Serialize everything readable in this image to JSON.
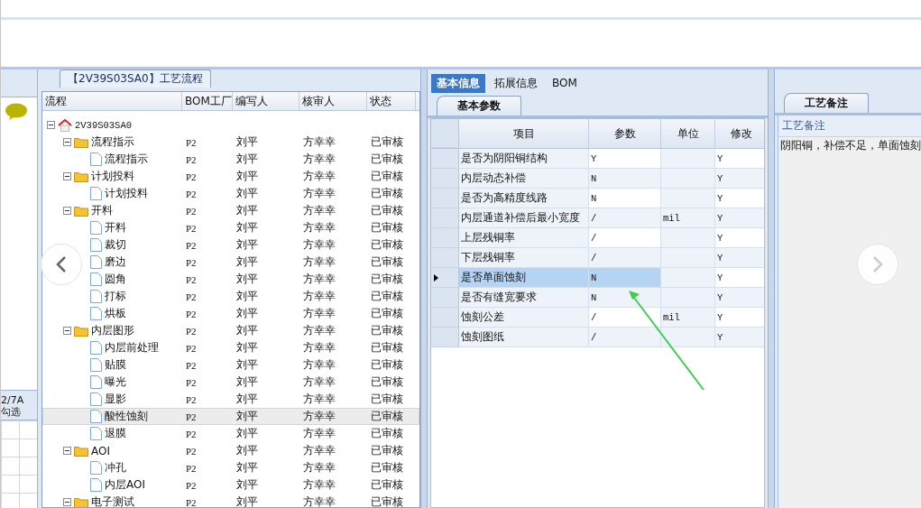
{
  "side_panel": {
    "texts": [
      "2/7A",
      "勾选"
    ]
  },
  "flow_panel": {
    "title": "【2V39S03SA0】工艺流程",
    "columns": [
      "流程",
      "BOM工厂",
      "编写人",
      "核审人",
      "状态"
    ],
    "tree": [
      {
        "label": "2V39S03SA0",
        "kind": "root",
        "expanded": true,
        "selected": false,
        "children": [
          {
            "label": "流程指示",
            "kind": "folder",
            "expanded": true,
            "selected": false,
            "cells": [
              "P2",
              "刘平",
              "方幸幸",
              "已审核"
            ],
            "children": [
              {
                "label": "流程指示",
                "kind": "file",
                "selected": false,
                "cells": [
                  "P2",
                  "刘平",
                  "方幸幸",
                  "已审核"
                ]
              }
            ]
          },
          {
            "label": "计划投料",
            "kind": "folder",
            "expanded": true,
            "selected": false,
            "cells": [
              "P2",
              "刘平",
              "方幸幸",
              "已审核"
            ],
            "children": [
              {
                "label": "计划投料",
                "kind": "file",
                "selected": false,
                "cells": [
                  "P2",
                  "刘平",
                  "方幸幸",
                  "已审核"
                ]
              }
            ]
          },
          {
            "label": "开料",
            "kind": "folder",
            "expanded": true,
            "selected": false,
            "cells": [
              "P2",
              "刘平",
              "方幸幸",
              "已审核"
            ],
            "children": [
              {
                "label": "开料",
                "kind": "file",
                "selected": false,
                "cells": [
                  "P2",
                  "刘平",
                  "方幸幸",
                  "已审核"
                ]
              },
              {
                "label": "裁切",
                "kind": "file",
                "selected": false,
                "cells": [
                  "P2",
                  "刘平",
                  "方幸幸",
                  "已审核"
                ]
              },
              {
                "label": "磨边",
                "kind": "file",
                "selected": false,
                "cells": [
                  "P2",
                  "刘平",
                  "方幸幸",
                  "已审核"
                ]
              },
              {
                "label": "圆角",
                "kind": "file",
                "selected": false,
                "cells": [
                  "P2",
                  "刘平",
                  "方幸幸",
                  "已审核"
                ]
              },
              {
                "label": "打标",
                "kind": "file",
                "selected": false,
                "cells": [
                  "P2",
                  "刘平",
                  "方幸幸",
                  "已审核"
                ]
              },
              {
                "label": "烘板",
                "kind": "file",
                "selected": false,
                "cells": [
                  "P2",
                  "刘平",
                  "方幸幸",
                  "已审核"
                ]
              }
            ]
          },
          {
            "label": "内层图形",
            "kind": "folder",
            "expanded": true,
            "selected": false,
            "cells": [
              "P2",
              "刘平",
              "方幸幸",
              "已审核"
            ],
            "children": [
              {
                "label": "内层前处理",
                "kind": "file",
                "selected": false,
                "cells": [
                  "P2",
                  "刘平",
                  "方幸幸",
                  "已审核"
                ]
              },
              {
                "label": "贴膜",
                "kind": "file",
                "selected": false,
                "cells": [
                  "P2",
                  "刘平",
                  "方幸幸",
                  "已审核"
                ]
              },
              {
                "label": "曝光",
                "kind": "file",
                "selected": false,
                "cells": [
                  "P2",
                  "刘平",
                  "方幸幸",
                  "已审核"
                ]
              },
              {
                "label": "显影",
                "kind": "file",
                "selected": false,
                "cells": [
                  "P2",
                  "刘平",
                  "方幸幸",
                  "已审核"
                ]
              },
              {
                "label": "酸性蚀刻",
                "kind": "file",
                "selected": true,
                "cells": [
                  "P2",
                  "刘平",
                  "方幸幸",
                  "已审核"
                ]
              },
              {
                "label": "退膜",
                "kind": "file",
                "selected": false,
                "cells": [
                  "P2",
                  "刘平",
                  "方幸幸",
                  "已审核"
                ]
              }
            ]
          },
          {
            "label": "AOI",
            "kind": "folder",
            "expanded": true,
            "selected": false,
            "cells": [
              "P2",
              "刘平",
              "方幸幸",
              "已审核"
            ],
            "children": [
              {
                "label": "冲孔",
                "kind": "file",
                "selected": false,
                "cells": [
                  "P2",
                  "刘平",
                  "方幸幸",
                  "已审核"
                ]
              },
              {
                "label": "内层AOI",
                "kind": "file",
                "selected": false,
                "cells": [
                  "P2",
                  "刘平",
                  "方幸幸",
                  "已审核"
                ]
              }
            ]
          },
          {
            "label": "电子测试",
            "kind": "folder",
            "expanded": true,
            "selected": false,
            "cells": [
              "P2",
              "刘平",
              "方幸幸",
              "已审核"
            ]
          }
        ]
      }
    ]
  },
  "info_panel": {
    "tabs": [
      {
        "label": "基本信息",
        "selected": true
      },
      {
        "label": "拓展信息",
        "selected": false
      },
      {
        "label": "BOM",
        "selected": false
      }
    ],
    "section_tab": "基本参数",
    "columns": [
      "项目",
      "参数",
      "单位",
      "修改"
    ],
    "rows": [
      {
        "cells": [
          "是否为阴阳铜结构",
          "Y",
          "",
          "Y"
        ],
        "selected": false
      },
      {
        "cells": [
          "内层动态补偿",
          "N",
          "",
          "Y"
        ],
        "selected": false
      },
      {
        "cells": [
          "是否为高精度线路",
          "N",
          "",
          "Y"
        ],
        "selected": false
      },
      {
        "cells": [
          "内层通道补偿后最小宽度",
          "/",
          "mil",
          "Y"
        ],
        "selected": false
      },
      {
        "cells": [
          "上层残铜率",
          "/",
          "",
          "Y"
        ],
        "selected": false
      },
      {
        "cells": [
          "下层残铜率",
          "/",
          "",
          "Y"
        ],
        "selected": false
      },
      {
        "cells": [
          "是否单面蚀刻",
          "N",
          "",
          "Y"
        ],
        "selected": true
      },
      {
        "cells": [
          "是否有缝宽要求",
          "N",
          "",
          "Y"
        ],
        "selected": false
      },
      {
        "cells": [
          "蚀刻公差",
          "/",
          "mil",
          "Y"
        ],
        "selected": false
      },
      {
        "cells": [
          "蚀刻图纸",
          "/",
          "",
          "Y"
        ],
        "selected": false
      }
    ]
  },
  "notes_panel": {
    "tab": "工艺备注",
    "label": "工艺备注",
    "text": "阴阳铜，补偿不足，单面蚀刻"
  }
}
